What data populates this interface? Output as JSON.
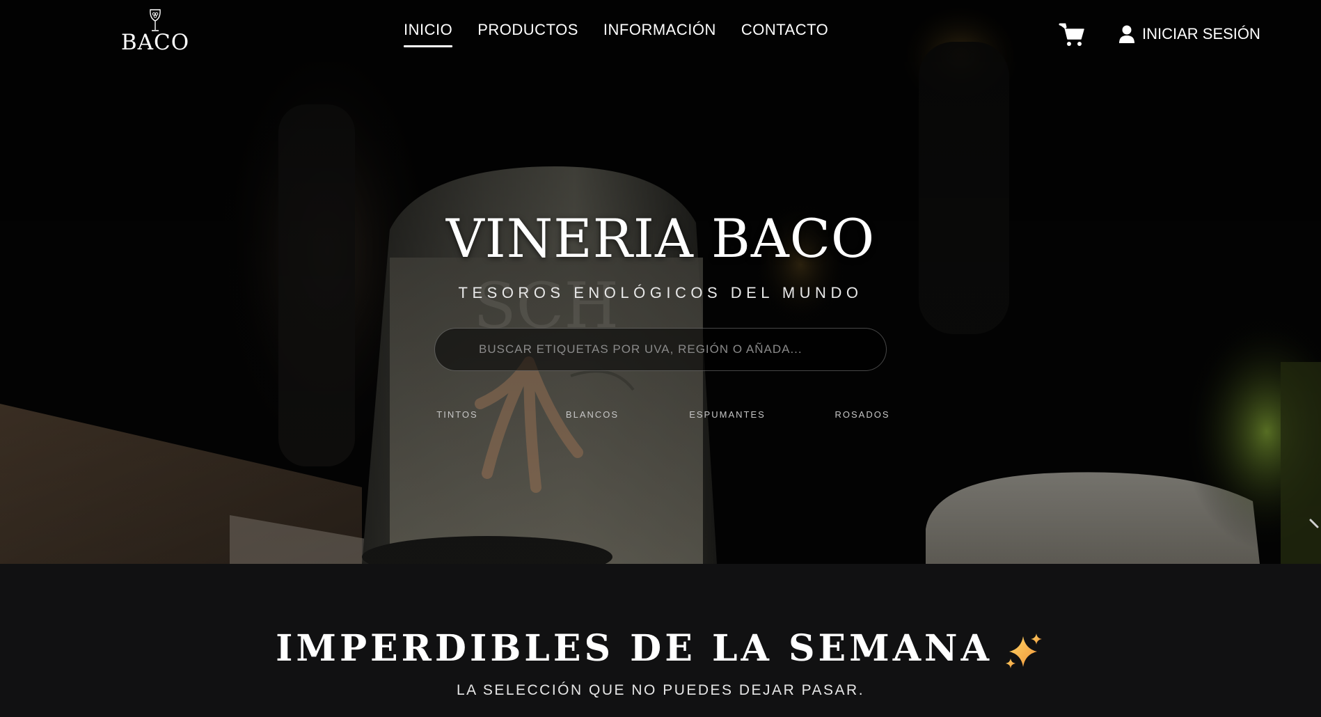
{
  "navbar": {
    "logo_text": "BACO",
    "links": [
      {
        "label": "INICIO",
        "active": true
      },
      {
        "label": "PRODUCTOS",
        "active": false
      },
      {
        "label": "INFORMACIÓN",
        "active": false
      },
      {
        "label": "CONTACTO",
        "active": false
      }
    ],
    "cart_icon": "shopping-cart-icon",
    "login_icon": "user-icon",
    "login_label": "INICIAR SESIÓN"
  },
  "hero": {
    "title": "VINERIA BACO",
    "subtitle": "TESOROS ENOLÓGICOS DEL MUNDO",
    "search": {
      "placeholder": "BUSCAR ETIQUETAS POR UVA, REGIÓN O AÑADA...",
      "value": ""
    },
    "categories": [
      "TINTOS",
      "BLANCOS",
      "ESPUMANTES",
      "ROSADOS"
    ],
    "background_label_text": "SCH",
    "carousel_arrow_icon": "chevron-right-icon"
  },
  "weekly": {
    "title": "IMPERDIBLES DE LA SEMANA",
    "title_icon": "sparkles-icon",
    "subtitle": "LA SELECCIÓN QUE NO PUEDES DEJAR PASAR."
  },
  "colors": {
    "background": "#111112",
    "text": "#ffffff",
    "muted_text": "#c7c7c7",
    "sparkle_gold": "#f4b63f"
  }
}
